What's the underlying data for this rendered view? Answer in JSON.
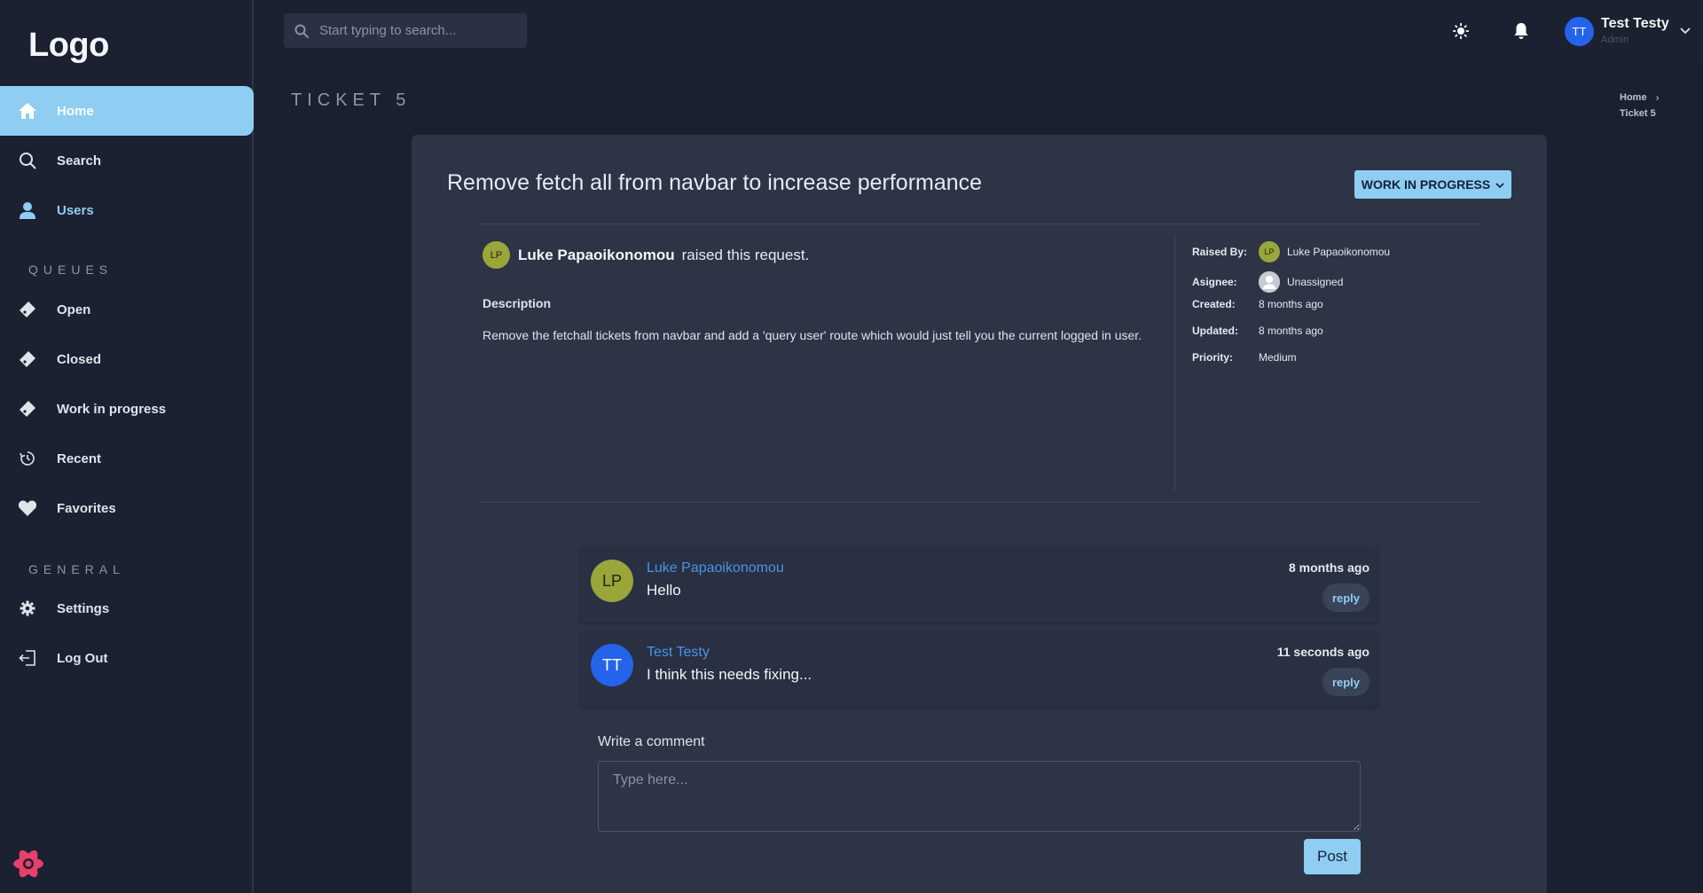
{
  "brand": {
    "logo_text": "Logo"
  },
  "sidebar": {
    "items": [
      {
        "label": "Home",
        "icon": "home-icon",
        "active": true
      },
      {
        "label": "Search",
        "icon": "search-icon"
      },
      {
        "label": "Users",
        "icon": "user-icon"
      }
    ],
    "queues_label": "QUEUES",
    "queues": [
      {
        "label": "Open",
        "icon": "ticket-icon"
      },
      {
        "label": "Closed",
        "icon": "ticket-icon"
      },
      {
        "label": "Work in progress",
        "icon": "ticket-icon"
      },
      {
        "label": "Recent",
        "icon": "history-icon"
      },
      {
        "label": "Favorites",
        "icon": "heart-icon"
      }
    ],
    "general_label": "GENERAL",
    "general": [
      {
        "label": "Settings",
        "icon": "gear-icon"
      },
      {
        "label": "Log Out",
        "icon": "logout-icon"
      }
    ]
  },
  "topbar": {
    "search_placeholder": "Start typing to search...",
    "user": {
      "initials": "TT",
      "name": "Test Testy",
      "role": "Admin"
    }
  },
  "page": {
    "title": "TICKET 5",
    "breadcrumb": [
      "Home",
      "Ticket 5"
    ]
  },
  "ticket": {
    "title": "Remove fetch all from navbar to increase performance",
    "status": "WORK IN PROGRESS",
    "raised_by_initials": "LP",
    "raised_by_name": "Luke Papaoikonomou",
    "raised_text": "raised this request.",
    "description_label": "Description",
    "description": "Remove the fetchall tickets from navbar and add a 'query user' route which would just tell you the current logged in user.",
    "meta": {
      "raised_by_label": "Raised By:",
      "raised_by_value": "Luke Papaoikonomou",
      "assignee_label": "Asignee:",
      "assignee_value": "Unassigned",
      "created_label": "Created:",
      "created_value": "8 months ago",
      "updated_label": "Updated:",
      "updated_value": "8 months ago",
      "priority_label": "Priority:",
      "priority_value": "Medium"
    }
  },
  "comments": [
    {
      "initials": "LP",
      "author": "Luke Papaoikonomou",
      "text": "Hello",
      "time": "8 months ago",
      "reply_label": "reply",
      "avatar_color": "#9aa53a"
    },
    {
      "initials": "TT",
      "author": "Test Testy",
      "text": "I think this needs fixing...",
      "time": "11 seconds ago",
      "reply_label": "reply",
      "avatar_color": "#2563eb"
    }
  ],
  "comment_form": {
    "label": "Write a comment",
    "placeholder": "Type here...",
    "post_label": "Post"
  },
  "colors": {
    "accent": "#8fcdf2",
    "link": "#4c92e8",
    "background": "#1a2030",
    "card": "#2c3446"
  }
}
